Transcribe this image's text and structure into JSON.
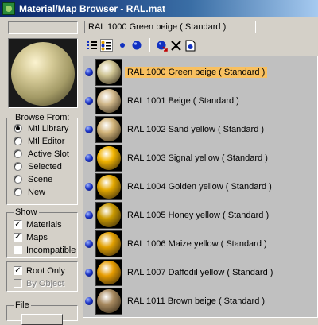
{
  "window": {
    "title": "Material/Map Browser - RAL.mat"
  },
  "name_field": {
    "value": ""
  },
  "current": {
    "value": "RAL 1000 Green beige  ( Standard )"
  },
  "browse_from": {
    "title": "Browse From:",
    "options": [
      {
        "label": "Mtl Library",
        "selected": true
      },
      {
        "label": "Mtl Editor",
        "selected": false
      },
      {
        "label": "Active Slot",
        "selected": false
      },
      {
        "label": "Selected",
        "selected": false
      },
      {
        "label": "Scene",
        "selected": false
      },
      {
        "label": "New",
        "selected": false
      }
    ]
  },
  "show": {
    "title": "Show",
    "options": [
      {
        "label": "Materials",
        "checked": true
      },
      {
        "label": "Maps",
        "checked": true
      },
      {
        "label": "Incompatible",
        "checked": false
      }
    ]
  },
  "filter": {
    "options": [
      {
        "label": "Root Only",
        "checked": true,
        "disabled": false
      },
      {
        "label": "By Object",
        "checked": false,
        "disabled": true
      }
    ]
  },
  "file": {
    "title": "File"
  },
  "toolbar": {
    "icons": [
      "view-list-icon",
      "view-list-icons-icon",
      "view-small-icons-icon",
      "view-large-icons-icon",
      "update-scene-materials-icon",
      "delete-from-library-icon",
      "clear-library-icon"
    ]
  },
  "materials": [
    {
      "name": "RAL 1000 Green beige  ( Standard )",
      "color": "#cfc493",
      "selected": true
    },
    {
      "name": "RAL 1001 Beige  ( Standard )",
      "color": "#d2b98c",
      "selected": false
    },
    {
      "name": "RAL 1002 Sand yellow  ( Standard )",
      "color": "#d2b47a",
      "selected": false
    },
    {
      "name": "RAL 1003 Signal yellow  ( Standard )",
      "color": "#f2b400",
      "selected": false
    },
    {
      "name": "RAL 1004 Golden yellow  ( Standard )",
      "color": "#e4a800",
      "selected": false
    },
    {
      "name": "RAL 1005 Honey yellow  ( Standard )",
      "color": "#cb9a00",
      "selected": false
    },
    {
      "name": "RAL 1006 Maize yellow  ( Standard )",
      "color": "#e2a000",
      "selected": false
    },
    {
      "name": "RAL 1007 Daffodil yellow  ( Standard )",
      "color": "#e69c00",
      "selected": false
    },
    {
      "name": "RAL 1011 Brown beige  ( Standard )",
      "color": "#a88a60",
      "selected": false
    }
  ],
  "colors": {
    "title_start": "#0a246a",
    "title_end": "#a6caf0",
    "selection": "#f8c060",
    "panel": "#d4d0c8",
    "list_bg": "#c0c0c0"
  }
}
